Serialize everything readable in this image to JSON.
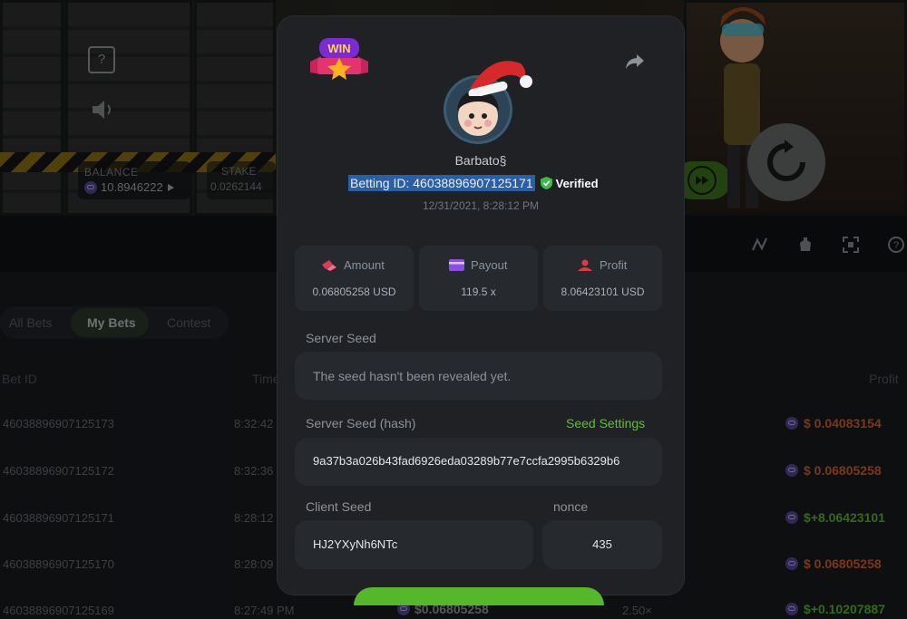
{
  "game": {
    "balance_label": "BALANCE",
    "balance_value": "10.8946222",
    "stake_label": "STAKE",
    "stake_value": "0.0262144",
    "help_glyph": "?"
  },
  "history": {
    "tabs": [
      {
        "label": "All Bets",
        "active": false
      },
      {
        "label": "My Bets",
        "active": true
      },
      {
        "label": "Contest",
        "active": false
      }
    ],
    "columns": {
      "bet_id": "Bet ID",
      "time": "Time",
      "profit": "Profit"
    },
    "rows": [
      {
        "id": "46038896907125173",
        "time": "8:32:42",
        "profit": "$ 0.04083154",
        "status": "loss"
      },
      {
        "id": "46038896907125172",
        "time": "8:32:36",
        "profit": "$ 0.06805258",
        "status": "loss"
      },
      {
        "id": "46038896907125171",
        "time": "8:28:12",
        "profit": "$+8.06423101",
        "status": "win"
      },
      {
        "id": "46038896907125170",
        "time": "8:28:09",
        "profit": "$ 0.06805258",
        "status": "loss"
      },
      {
        "id": "46038896907125169",
        "time": "8:27:49 PM",
        "amount": "$0.06805258",
        "multiplier": "2.50×",
        "profit": "$+0.10207887",
        "status": "win"
      }
    ]
  },
  "modal": {
    "badge_text": "WIN",
    "username": "Barbato§",
    "betting_id": "Betting ID: 46038896907125171",
    "verified_label": "Verified",
    "datetime": "12/31/2021, 8:28:12 PM",
    "stats": [
      {
        "label": "Amount",
        "value": "0.06805258 USD",
        "icon": "amount-icon"
      },
      {
        "label": "Payout",
        "value": "119.5 x",
        "icon": "payout-card-icon"
      },
      {
        "label": "Profit",
        "value": "8.06423101 USD",
        "icon": "profit-icon"
      }
    ],
    "server_seed_label": "Server Seed",
    "server_seed_value": "The seed hasn't been revealed yet.",
    "server_seed_hash_label": "Server Seed (hash)",
    "seed_settings_label": "Seed Settings",
    "server_seed_hash_value": "9a37b3a026b43fad6926eda03289b77e7ccfa2995b6329b6",
    "client_seed_label": "Client Seed",
    "client_seed_value": "HJ2YXyNh6NTc",
    "nonce_label": "nonce",
    "nonce_value": "435"
  },
  "colors": {
    "accent_green": "#5dc12f",
    "loss_orange": "#e2642a",
    "win_green": "#5dc12f",
    "highlight_blue": "#2a5fa6"
  }
}
